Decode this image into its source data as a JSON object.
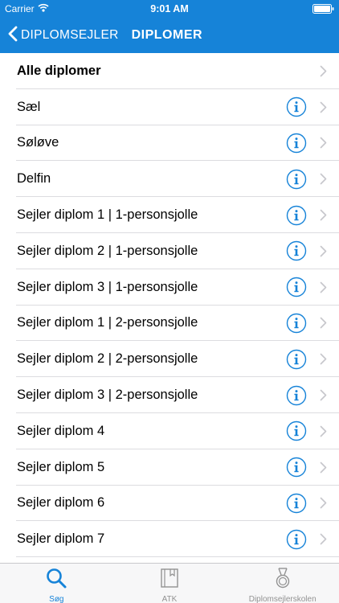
{
  "status_bar": {
    "carrier": "Carrier",
    "time": "9:01 AM"
  },
  "nav": {
    "back_label": "DIPLOMSEJLER",
    "title": "DIPLOMER"
  },
  "list": [
    {
      "label": "Alle diplomer",
      "bold": true,
      "info": false
    },
    {
      "label": "Sæl",
      "bold": false,
      "info": true
    },
    {
      "label": "Søløve",
      "bold": false,
      "info": true
    },
    {
      "label": "Delfin",
      "bold": false,
      "info": true
    },
    {
      "label": "Sejler diplom 1 | 1-personsjolle",
      "bold": false,
      "info": true
    },
    {
      "label": "Sejler diplom 2 | 1-personsjolle",
      "bold": false,
      "info": true
    },
    {
      "label": "Sejler diplom 3 | 1-personsjolle",
      "bold": false,
      "info": true
    },
    {
      "label": "Sejler diplom 1 | 2-personsjolle",
      "bold": false,
      "info": true
    },
    {
      "label": "Sejler diplom 2 | 2-personsjolle",
      "bold": false,
      "info": true
    },
    {
      "label": "Sejler diplom 3 | 2-personsjolle",
      "bold": false,
      "info": true
    },
    {
      "label": "Sejler diplom 4",
      "bold": false,
      "info": true
    },
    {
      "label": "Sejler diplom 5",
      "bold": false,
      "info": true
    },
    {
      "label": "Sejler diplom 6",
      "bold": false,
      "info": true
    },
    {
      "label": "Sejler diplom 7",
      "bold": false,
      "info": true
    }
  ],
  "tabs": [
    {
      "label": "Søg",
      "icon": "search-icon",
      "active": true
    },
    {
      "label": "ATK",
      "icon": "book-icon",
      "active": false
    },
    {
      "label": "Diplomsejlerskolen",
      "icon": "medal-icon",
      "active": false
    }
  ],
  "colors": {
    "accent": "#1683d8",
    "inactive": "#929292",
    "separator": "#dcdce0",
    "chevron": "#c7c7cc"
  }
}
